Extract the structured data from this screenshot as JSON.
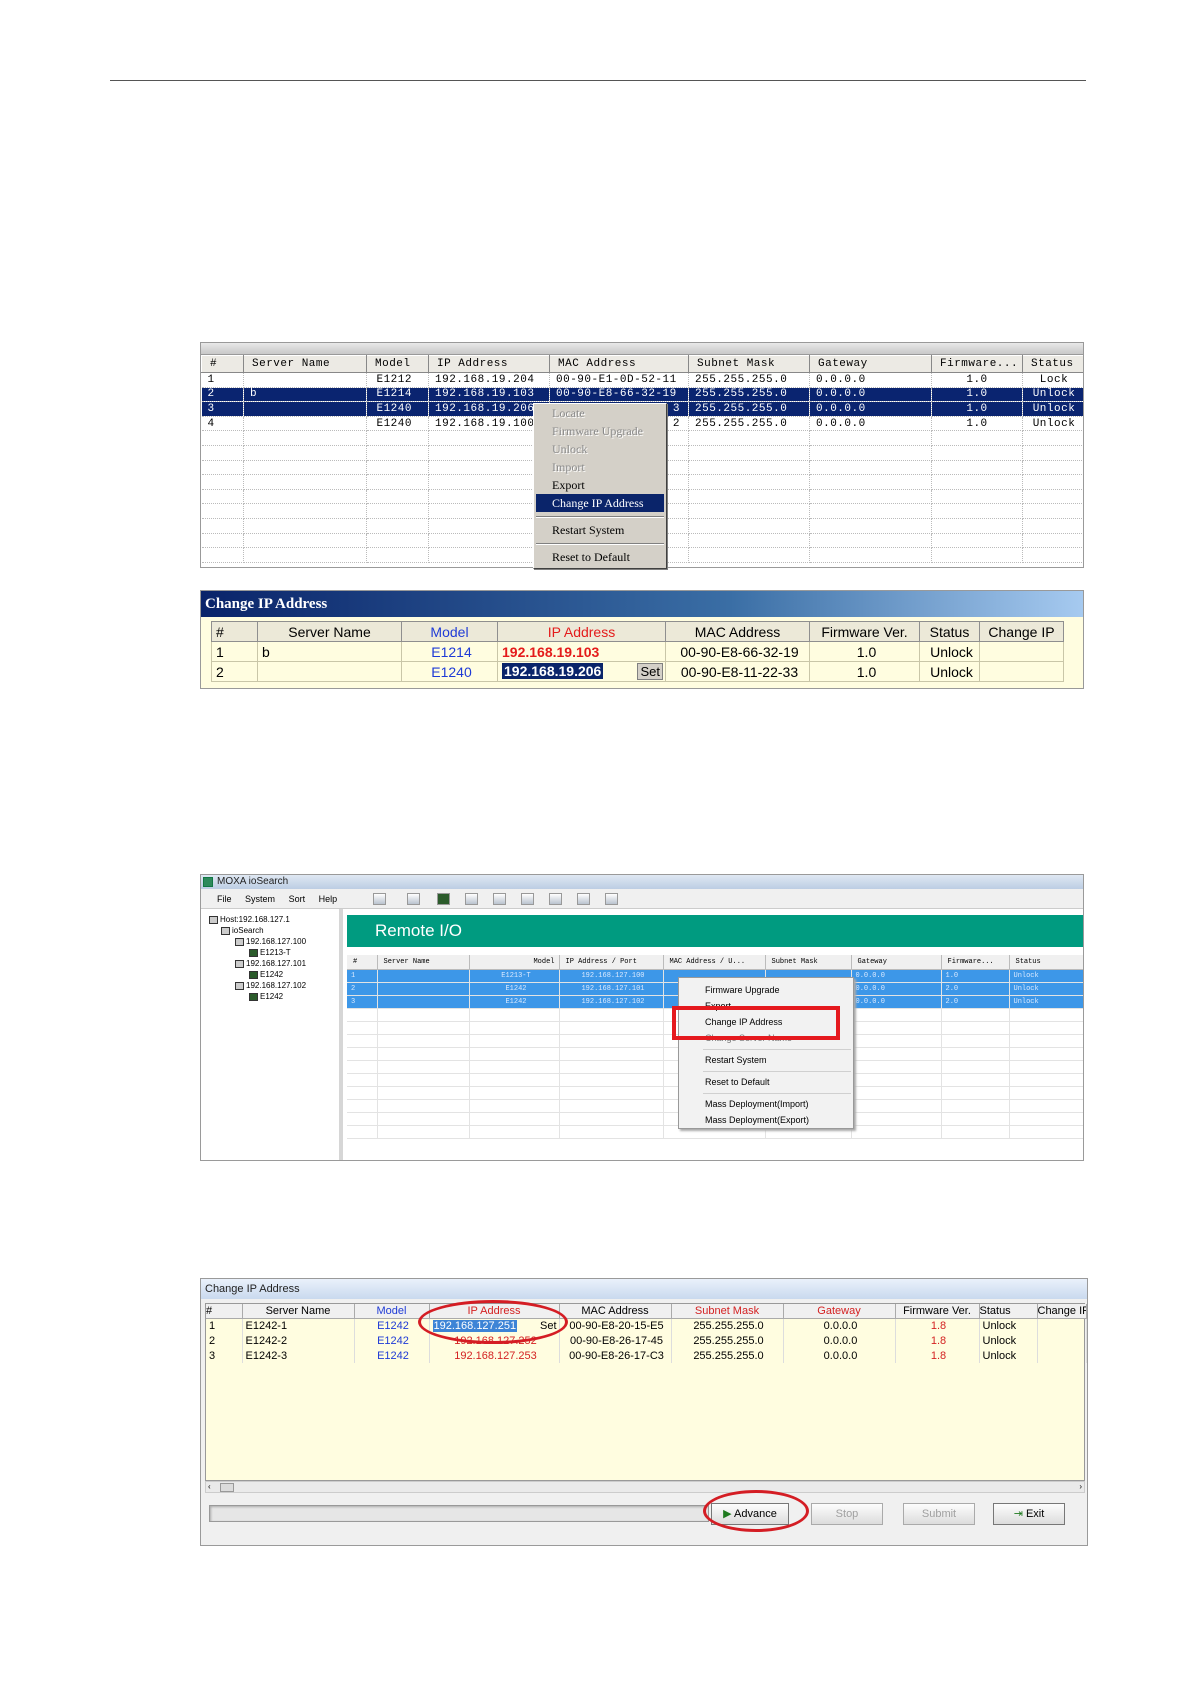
{
  "panel1": {
    "columns": [
      "#",
      "Server Name",
      "Model",
      "IP Address",
      "MAC Address",
      "Subnet Mask",
      "Gateway",
      "Firmware...",
      "Status"
    ],
    "rows": [
      {
        "num": "1",
        "name": "",
        "model": "E1212",
        "ip": "192.168.19.204",
        "mac": "00-90-E1-0D-52-11",
        "mask": "255.255.255.0",
        "gw": "0.0.0.0",
        "fw": "1.0",
        "status": "Lock"
      },
      {
        "num": "2",
        "name": "b",
        "model": "E1214",
        "ip": "192.168.19.103",
        "mac": "00-90-E8-66-32-19",
        "mask": "255.255.255.0",
        "gw": "0.0.0.0",
        "fw": "1.0",
        "status": "Unlock"
      },
      {
        "num": "3",
        "name": "",
        "model": "E1240",
        "ip": "192.168.19.206",
        "mac": "3",
        "mask": "255.255.255.0",
        "gw": "0.0.0.0",
        "fw": "1.0",
        "status": "Unlock"
      },
      {
        "num": "4",
        "name": "",
        "model": "E1240",
        "ip": "192.168.19.100",
        "mac": "2",
        "mask": "255.255.255.0",
        "gw": "0.0.0.0",
        "fw": "1.0",
        "status": "Unlock"
      }
    ],
    "menu": [
      "Locate",
      "Firmware Upgrade",
      "Unlock",
      "Import",
      "Export",
      "Change IP Address",
      "Restart System",
      "Reset to Default"
    ]
  },
  "panel2": {
    "title": "Change IP Address",
    "columns": [
      "#",
      "Server Name",
      "Model",
      "IP Address",
      "MAC Address",
      "Firmware Ver.",
      "Status",
      "Change IP"
    ],
    "rows": [
      {
        "num": "1",
        "name": "b",
        "model": "E1214",
        "ip": "192.168.19.103",
        "mac": "00-90-E8-66-32-19",
        "fw": "1.0",
        "status": "Unlock"
      },
      {
        "num": "2",
        "name": "",
        "model": "E1240",
        "ip": "192.168.19.206",
        "set": "Set",
        "mac": "00-90-E8-11-22-33",
        "fw": "1.0",
        "status": "Unlock"
      }
    ]
  },
  "panel3": {
    "window_title": "MOXA ioSearch",
    "menus": [
      "File",
      "System",
      "Sort",
      "Help"
    ],
    "tree": [
      "Host:192.168.127.1",
      "ioSearch",
      "192.168.127.100",
      "E1213-T",
      "192.168.127.101",
      "E1242",
      "192.168.127.102",
      "E1242"
    ],
    "header": "Remote I/O",
    "columns": [
      "#",
      "Server Name",
      "Model",
      "IP Address / Port",
      "MAC Address / U...",
      "Subnet Mask",
      "Gateway",
      "Firmware...",
      "Status"
    ],
    "rows": [
      {
        "num": "1",
        "model": "E1213-T",
        "ip": "192.168.127.100",
        "gw": "0.0.0.0",
        "fw": "1.0",
        "status": "Unlock"
      },
      {
        "num": "2",
        "model": "E1242",
        "ip": "192.168.127.101",
        "gw": "0.0.0.0",
        "fw": "2.0",
        "status": "Unlock"
      },
      {
        "num": "3",
        "model": "E1242",
        "ip": "192.168.127.102",
        "gw": "0.0.0.0",
        "fw": "2.0",
        "status": "Unlock"
      }
    ],
    "menu": [
      "Firmware Upgrade",
      "Export",
      "Change IP Address",
      "Change Server Name",
      "Restart System",
      "Reset to Default",
      "Mass Deployment(Import)",
      "Mass Deployment(Export)"
    ]
  },
  "panel4": {
    "title": "Change IP Address",
    "columns": [
      "#",
      "Server Name",
      "Model",
      "IP Address",
      "MAC Address",
      "Subnet Mask",
      "Gateway",
      "Firmware Ver.",
      "Status",
      "Change IP"
    ],
    "rows": [
      {
        "num": "1",
        "name": "E1242-1",
        "model": "E1242",
        "ip": "192.168.127.251",
        "set": "Set",
        "mac": "00-90-E8-20-15-E5",
        "mask": "255.255.255.0",
        "gw": "0.0.0.0",
        "fw": "1.8",
        "status": "Unlock"
      },
      {
        "num": "2",
        "name": "E1242-2",
        "model": "E1242",
        "ip": "192.168.127.252",
        "mac": "00-90-E8-26-17-45",
        "mask": "255.255.255.0",
        "gw": "0.0.0.0",
        "fw": "1.8",
        "status": "Unlock"
      },
      {
        "num": "3",
        "name": "E1242-3",
        "model": "E1242",
        "ip": "192.168.127.253",
        "mac": "00-90-E8-26-17-C3",
        "mask": "255.255.255.0",
        "gw": "0.0.0.0",
        "fw": "1.8",
        "status": "Unlock"
      }
    ],
    "buttons": {
      "advance": "Advance",
      "stop": "Stop",
      "submit": "Submit",
      "exit": "Exit"
    }
  }
}
